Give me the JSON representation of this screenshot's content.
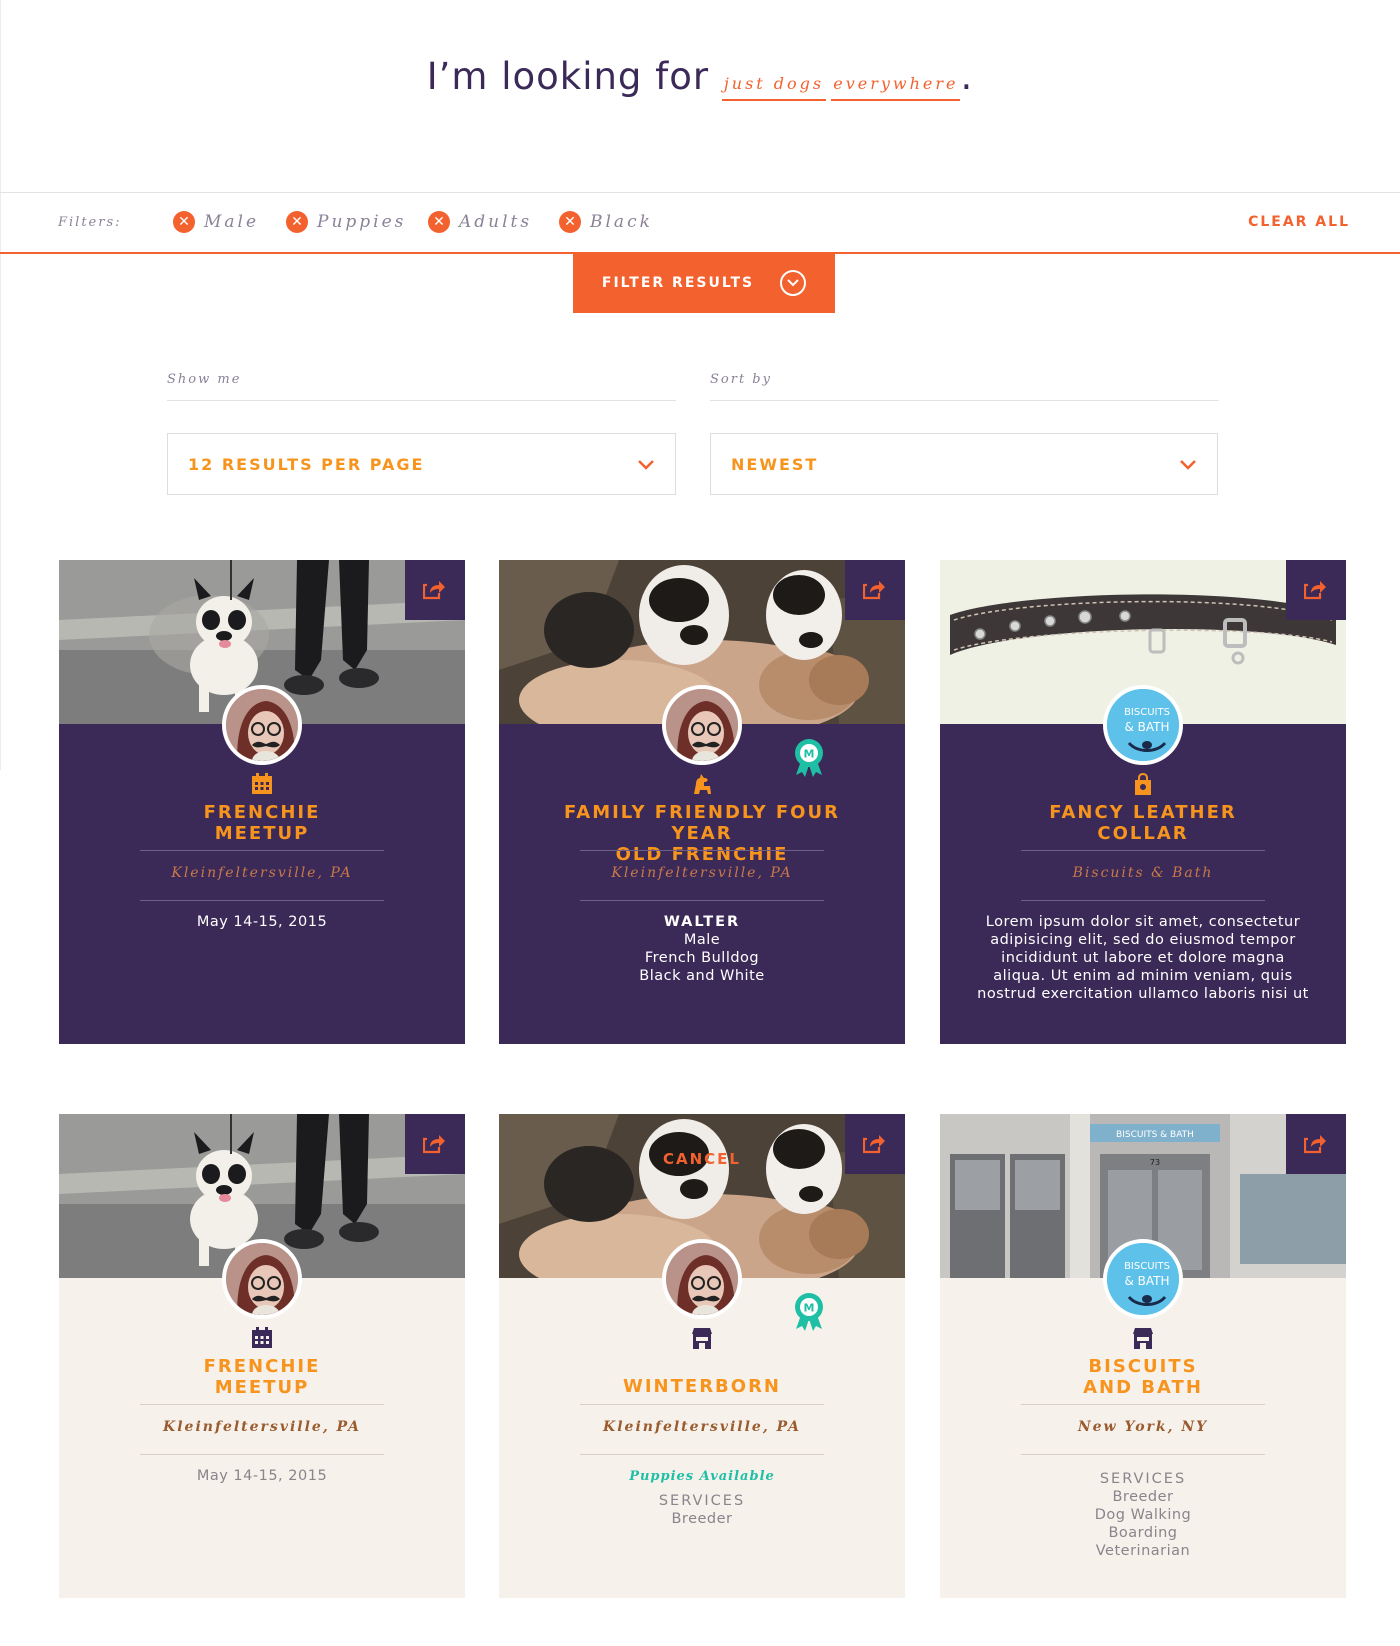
{
  "hero": {
    "prefix": "I’m looking for ",
    "choice1": "just dogs",
    "choice2": "everywhere",
    "suffix": "."
  },
  "filters": {
    "label": "Filters:",
    "chips": [
      "Male",
      "Puppies",
      "Adults",
      "Black"
    ],
    "clear_all": "CLEAR ALL",
    "filter_results": "FILTER RESULTS"
  },
  "controls": {
    "show_me_label": "Show me",
    "show_me_value": "12 RESULTS PER PAGE",
    "sort_by_label": "Sort by",
    "sort_by_value": "NEWEST"
  },
  "colors": {
    "accent_orange": "#f2612e",
    "title_orange": "#f7941d",
    "purple": "#3b2a57",
    "teal": "#1fbfa6",
    "cream": "#f7f1ec"
  },
  "cards": [
    {
      "title_line1": "FRENCHIE",
      "title_line2": "MEETUP",
      "location": "Kleinfeltersville, PA",
      "body": [
        "May 14-15, 2015"
      ],
      "type_icon": "calendar-icon"
    },
    {
      "title_line1": "FAMILY FRIENDLY FOUR YEAR",
      "title_line2": "OLD FRENCHIE",
      "location": "Kleinfeltersville, PA",
      "body_name": "WALTER",
      "body": [
        "Male",
        "French Bulldog",
        "Black and White"
      ],
      "type_icon": "dog-icon"
    },
    {
      "title_line1": "FANCY LEATHER",
      "title_line2": "COLLAR",
      "location": "Biscuits & Bath",
      "body": [
        "Lorem ipsum dolor sit amet, consectetur",
        "adipisicing elit, sed do eiusmod tempor",
        "incididunt ut labore et dolore magna",
        "aliqua. Ut enim ad minim veniam, quis",
        "nostrud exercitation ullamco laboris nisi ut"
      ],
      "type_icon": "shopping-bag-icon",
      "logo_text1": "BISCUITS",
      "logo_text2": "& BATH"
    },
    {
      "title_line1": "FRENCHIE",
      "title_line2": "MEETUP",
      "location": "Kleinfeltersville, PA",
      "body": [
        "May 14-15, 2015"
      ],
      "type_icon": "calendar-icon"
    },
    {
      "title_line1": "WINTERBORN",
      "location": "Kleinfeltersville, PA",
      "puppies": "Puppies Available",
      "services_label": "SERVICES",
      "body": [
        "Breeder"
      ],
      "cancel": "CANCEL",
      "type_icon": "storefront-icon"
    },
    {
      "title_line1": "BISCUITS",
      "title_line2": "AND BATH",
      "location": "New York, NY",
      "services_label": "SERVICES",
      "body": [
        "Breeder",
        "Dog Walking",
        "Boarding",
        "Veterinarian"
      ],
      "type_icon": "storefront-icon",
      "logo_text1": "BISCUITS",
      "logo_text2": "& BATH",
      "store_sign": "BISCUITS & BATH",
      "store_number": "73"
    }
  ]
}
